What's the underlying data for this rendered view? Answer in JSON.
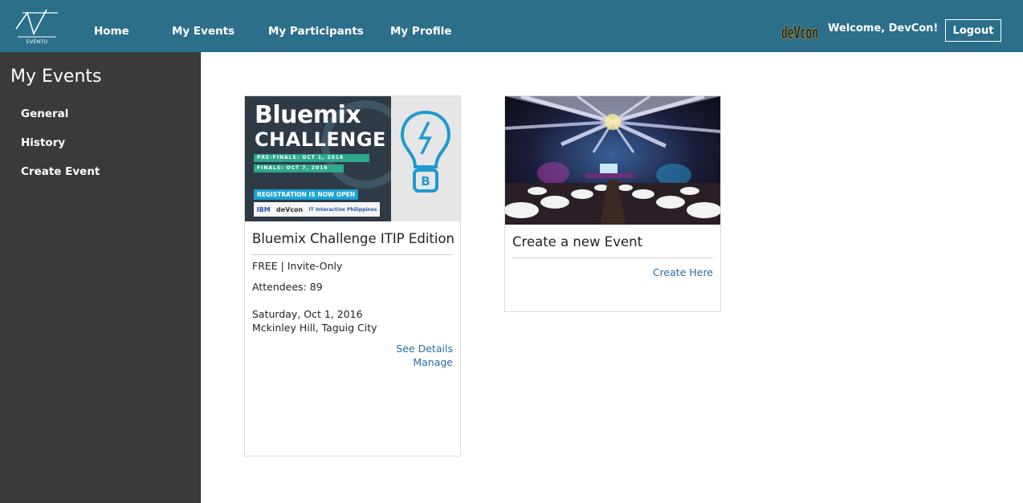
{
  "nav": {
    "logo_text": "EVENTO",
    "home": "Home",
    "my_events": "My Events",
    "my_participants": "My Participants",
    "my_profile": "My Profile",
    "brand_logo_text": "deVcon",
    "welcome": "Welcome, DevCon!",
    "logout": "Logout"
  },
  "sidebar": {
    "title": "My Events",
    "items": [
      {
        "label": "General"
      },
      {
        "label": "History"
      },
      {
        "label": "Create Event"
      }
    ]
  },
  "event_card": {
    "banner": {
      "title_line1": "Bluemix",
      "title_line2": "CHALLENGE",
      "prefinals": "PRE-FINALS: OCT 1, 2016",
      "finals": "FINALS: OCT 7, 2016",
      "registration": "REGISTRATION IS NOW OPEN",
      "sponsor1": "IBM",
      "sponsor2": "deVcon",
      "sponsor3": "IT Interactive Philippines"
    },
    "title": "Bluemix Challenge ITIP Edition",
    "price_type": "FREE | Invite-Only",
    "attendees": "Attendees: 89",
    "date": "Saturday, Oct 1, 2016",
    "location": "Mckinley Hill, Taguig City",
    "see_details": "See Details",
    "manage": "Manage"
  },
  "create_card": {
    "title": "Create a new Event",
    "link": "Create Here"
  },
  "colors": {
    "topbar": "#2b6f8a",
    "sidebar": "#3a3a3a",
    "link": "#2a6aa8"
  }
}
